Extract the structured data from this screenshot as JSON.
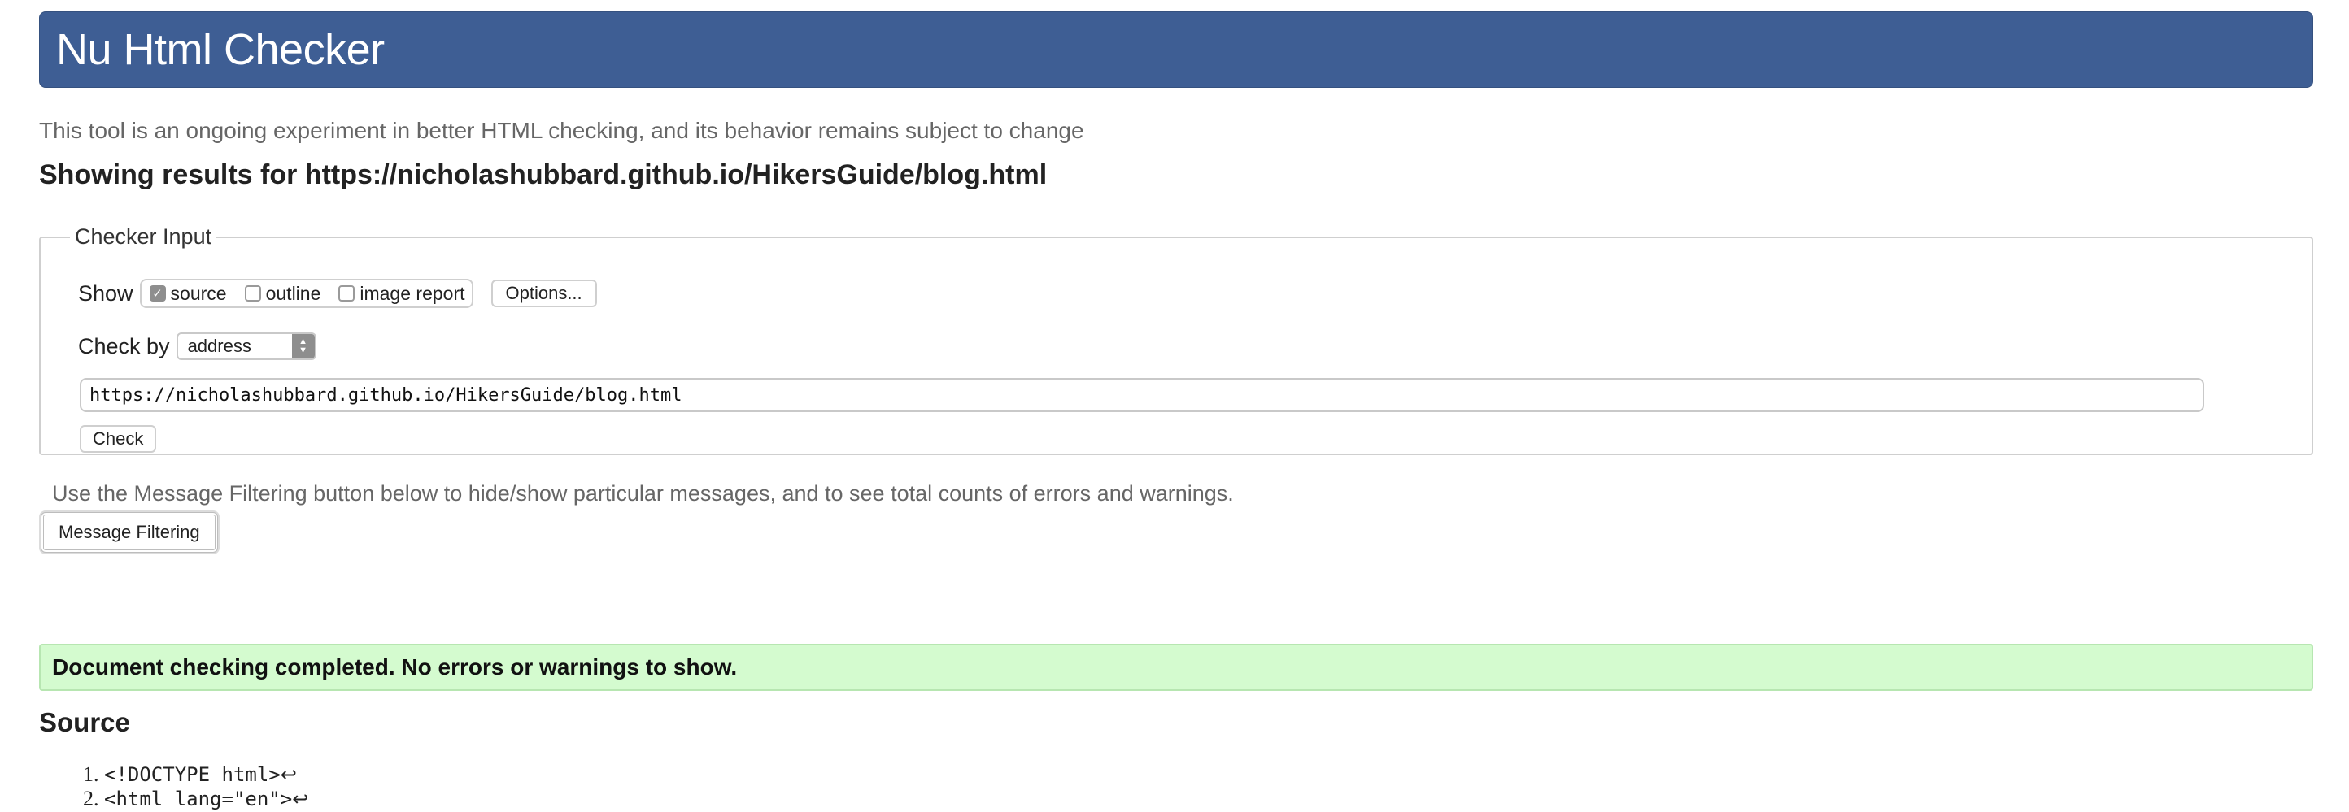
{
  "header": {
    "title": "Nu Html Checker"
  },
  "intro": "This tool is an ongoing experiment in better HTML checking, and its behavior remains subject to change",
  "results": {
    "prefix": "Showing results for",
    "url": "https://nicholashubbard.github.io/HikersGuide/blog.html"
  },
  "checker": {
    "legend": "Checker Input",
    "show_label": "Show",
    "options": [
      {
        "label": "source",
        "checked": true
      },
      {
        "label": "outline",
        "checked": false
      },
      {
        "label": "image report",
        "checked": false
      }
    ],
    "options_button": "Options...",
    "check_by_label": "Check by",
    "check_by_value": "address",
    "url_value": "https://nicholashubbard.github.io/HikersGuide/blog.html",
    "check_button": "Check"
  },
  "filter": {
    "note": "Use the Message Filtering button below to hide/show particular messages, and to see total counts of errors and warnings.",
    "button": "Message Filtering"
  },
  "status": {
    "message": "Document checking completed. No errors or warnings to show."
  },
  "source": {
    "heading": "Source",
    "lines": [
      "<!DOCTYPE html>",
      "<html lang=\"en\">"
    ],
    "return_symbol": "↩"
  },
  "colors": {
    "header_bg": "#3e5e94",
    "success_bg": "#d4fbcf"
  }
}
